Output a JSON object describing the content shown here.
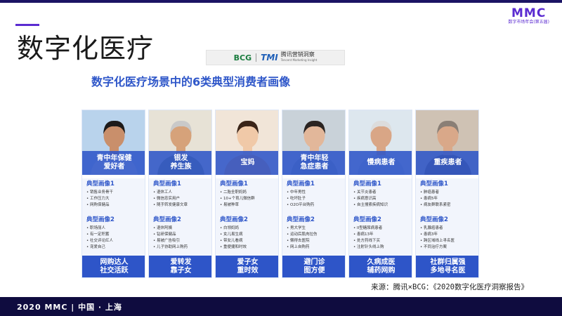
{
  "logo": {
    "main": "MMC",
    "sub": "数字市场年会(第五届)"
  },
  "page": {
    "title": "数字化医疗",
    "subtitle": "数字化医疗场景中的6类典型消费者画像"
  },
  "brands": {
    "bcg": "BCG",
    "tmi": "TMI",
    "tmi_cn": "腾讯营销洞察",
    "tmi_en": "Tencent Marketing Insight"
  },
  "group_titles": {
    "first": "典型画像1",
    "second": "典型画像2"
  },
  "cards": [
    {
      "label": "青中年保健\n爱好者",
      "persona1": [
        "销售业务骨干",
        "工作压力大",
        "网购保健品"
      ],
      "persona2": [
        "职场丽人",
        "有一定积蓄",
        "社交评论红人",
        "宠爱自己"
      ],
      "footer": "网购达人\n社交活跃",
      "photo_colors": {
        "bg": "#b9d3ec",
        "skin": "#c98f6b",
        "hair": "#1d1a1a",
        "cloth": "#e8e8e8"
      }
    },
    {
      "label": "银发\n养生族",
      "persona1": [
        "退休工人",
        "微信忠实用户",
        "随手转发健康文章"
      ],
      "persona2": [
        "退休阿姨",
        "钻研保健品",
        "易被广告吸引",
        "儿子协助网上购药"
      ],
      "footer": "爱转发\n靠子女",
      "photo_colors": {
        "bg": "#e7e2d6",
        "skin": "#d6a27a",
        "hair": "#c9c9c9",
        "cloth": "#7a8c6a"
      }
    },
    {
      "label": "宝妈",
      "persona1": [
        "二胎全职妈妈",
        "10+个育儿微信群",
        "易被种草"
      ],
      "persona2": [
        "白领妈妈",
        "女儿易生病",
        "带女儿看病",
        "重便捷和时效"
      ],
      "footer": "爱子女\n重时效",
      "photo_colors": {
        "bg": "#f1e5d8",
        "skin": "#f0c9a8",
        "hair": "#3a2418",
        "cloth": "#f6a46a"
      }
    },
    {
      "label": "青中年轻\n急症患者",
      "persona1": [
        "中年男性",
        "吃坏肚子",
        "O2O平台购药"
      ],
      "persona2": [
        "男大学生",
        "运动后肌肉拉伤",
        "懒得去医院",
        "网上自购药"
      ],
      "footer": "避门诊\n图方便",
      "photo_colors": {
        "bg": "#c9d2d9",
        "skin": "#e2b79a",
        "hair": "#2a2422",
        "cloth": "#9aa9b5"
      }
    },
    {
      "label": "慢病患者",
      "persona1": [
        "关节炎患者",
        "疾病意识高",
        "自主搜索疾病知识"
      ],
      "persona2": [
        "II型糖尿病患者",
        "患病13年",
        "处方药线下买",
        "注射针头线上购"
      ],
      "footer": "久病成医\n辅药网购",
      "photo_colors": {
        "bg": "#dde7ee",
        "skin": "#d9a686",
        "hair": "#dcdcdc",
        "cloth": "#b8c9d8"
      }
    },
    {
      "label": "重疾患者",
      "persona1": [
        "肺癌患者",
        "患病5年",
        "病友群联系紧密"
      ],
      "persona2": [
        "乳腺癌患者",
        "患病3年",
        "跨区域线上寻名医",
        "不同治疗方案"
      ],
      "footer": "社群归属强\n多地寻名医",
      "photo_colors": {
        "bg": "#cfc2b4",
        "skin": "#d9a889",
        "hair": "#8a7f76",
        "cloth": "#6f5c4f"
      }
    }
  ],
  "source": "来源：腾讯×BCG：《2020数字化医疗洞察报告》",
  "footer": "2020 MMC | 中国 · 上海",
  "colors": {
    "primary": "#2e55c8",
    "accent": "#5b2bd1",
    "footer_bg": "#0f0c3f"
  }
}
